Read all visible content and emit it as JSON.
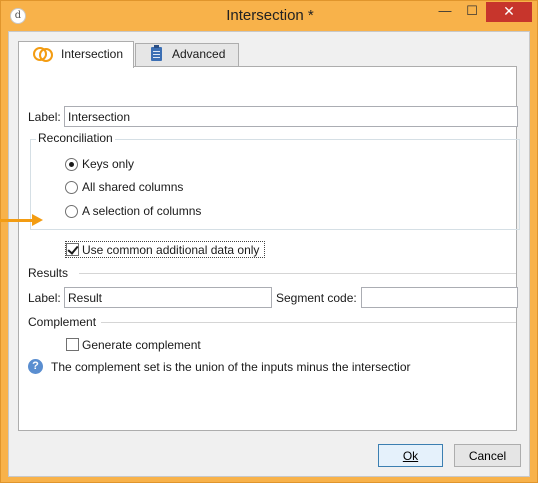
{
  "window": {
    "title": "Intersection *",
    "app_icon_glyph": "d",
    "minimize_glyph": "—",
    "maximize_glyph": "☐",
    "close_glyph": "✕",
    "accent_color": "#f8b24a"
  },
  "tabs": [
    {
      "label": "Intersection",
      "icon": "intersection-circles-icon",
      "active": true
    },
    {
      "label": "Advanced",
      "icon": "clipboard-icon",
      "active": false
    }
  ],
  "form": {
    "label_caption": "Label:",
    "label_value": "Intersection",
    "reconciliation": {
      "title": "Reconciliation",
      "options": [
        {
          "label": "Keys only",
          "selected": true
        },
        {
          "label": "All shared columns",
          "selected": false
        },
        {
          "label": "A selection of columns",
          "selected": false
        }
      ]
    },
    "use_common_data": {
      "label": "Use common additional data only",
      "checked": true
    },
    "results": {
      "title": "Results",
      "label_caption": "Label:",
      "label_value": "Result",
      "segment_caption": "Segment code:",
      "segment_value": ""
    },
    "complement": {
      "title": "Complement",
      "generate_label": "Generate complement",
      "generate_checked": false,
      "info_text": "The complement set is the union of the inputs minus the intersectior"
    }
  },
  "buttons": {
    "ok_label": "Ok",
    "cancel_label": "Cancel"
  }
}
